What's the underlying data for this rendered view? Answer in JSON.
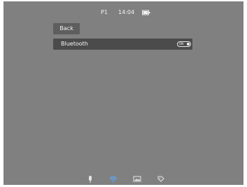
{
  "status_bar": {
    "page": "P1",
    "time": "14:04",
    "battery_icon": "battery-icon"
  },
  "menu": {
    "back_label": "Back",
    "bluetooth_label": "Bluetooth",
    "bluetooth_toggle_text": "ON",
    "bluetooth_toggle_state": "on"
  },
  "bottom_bar": {
    "icons": [
      "microphone-icon",
      "wifi-icon",
      "image-icon",
      "tag-icon"
    ],
    "active_icon": "wifi-icon"
  },
  "colors": {
    "screen_bg": "#808080",
    "selected_row": "#4b4b4b",
    "back_button": "#5e5e5e",
    "text": "#f5f5f5",
    "active_icon": "#5da9ff",
    "inactive_icon": "#e6e6e6"
  }
}
